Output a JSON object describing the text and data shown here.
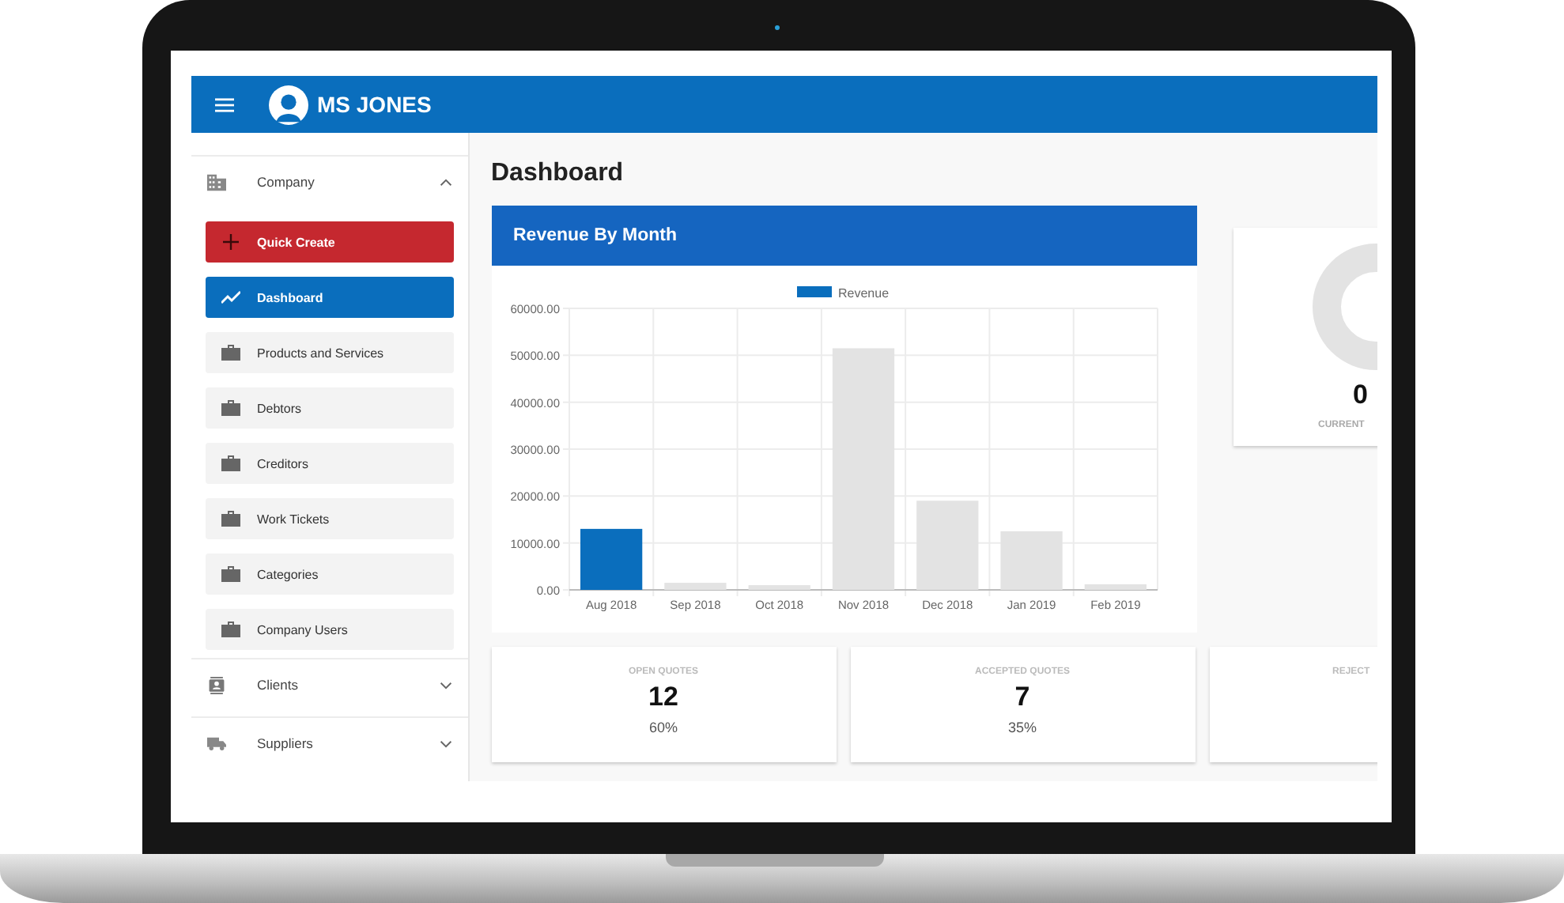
{
  "header": {
    "title": "MS JONES"
  },
  "sidebar": {
    "groups": [
      {
        "label": "Company",
        "expanded": true,
        "items": [
          {
            "label": "Quick Create",
            "kind": "create"
          },
          {
            "label": "Dashboard",
            "kind": "chart",
            "selected": true
          },
          {
            "label": "Products and Services",
            "kind": "folder",
            "selected": false
          },
          {
            "label": "Debtors",
            "kind": "folder",
            "selected": false
          },
          {
            "label": "Creditors",
            "kind": "folder",
            "selected": false
          },
          {
            "label": "Work Tickets",
            "kind": "folder",
            "selected": false
          },
          {
            "label": "Categories",
            "kind": "folder",
            "selected": false
          },
          {
            "label": "Company Users",
            "kind": "folder",
            "selected": false
          }
        ]
      },
      {
        "label": "Clients",
        "expanded": false
      },
      {
        "label": "Suppliers",
        "expanded": false
      }
    ]
  },
  "main": {
    "title": "Dashboard",
    "revenue_card": {
      "title": "Revenue By Month",
      "chart_data": {
        "type": "bar",
        "categories": [
          "Aug 2018",
          "Sep 2018",
          "Oct 2018",
          "Nov 2018",
          "Dec 2018",
          "Jan 2019",
          "Feb 2019"
        ],
        "series": [
          {
            "name": "Revenue",
            "color": "#0a6ebd",
            "values": [
              13000,
              null,
              null,
              null,
              null,
              null,
              null
            ]
          },
          {
            "color": "#e3e3e3",
            "values": [
              null,
              1500,
              1000,
              51500,
              19000,
              12500,
              1200
            ]
          }
        ],
        "grid": true,
        "ylim": [
          0,
          60000
        ],
        "yticks": [
          {
            "value": 0,
            "label": "0.00"
          },
          {
            "value": 10000,
            "label": "10000.00"
          },
          {
            "value": 20000,
            "label": "20000.00"
          },
          {
            "value": 30000,
            "label": "30000.00"
          },
          {
            "value": 40000,
            "label": "40000.00"
          },
          {
            "value": 50000,
            "label": "50000.00"
          },
          {
            "value": 60000,
            "label": "60000.00"
          }
        ]
      }
    },
    "gauge_card": {
      "value": "0",
      "label": "CURRENT"
    },
    "stat_cards": [
      {
        "label": "OPEN QUOTES",
        "value": "12",
        "percent": "60%"
      },
      {
        "label": "ACCEPTED QUOTES",
        "value": "7",
        "percent": "35%"
      },
      {
        "label": "REJECT"
      }
    ]
  }
}
